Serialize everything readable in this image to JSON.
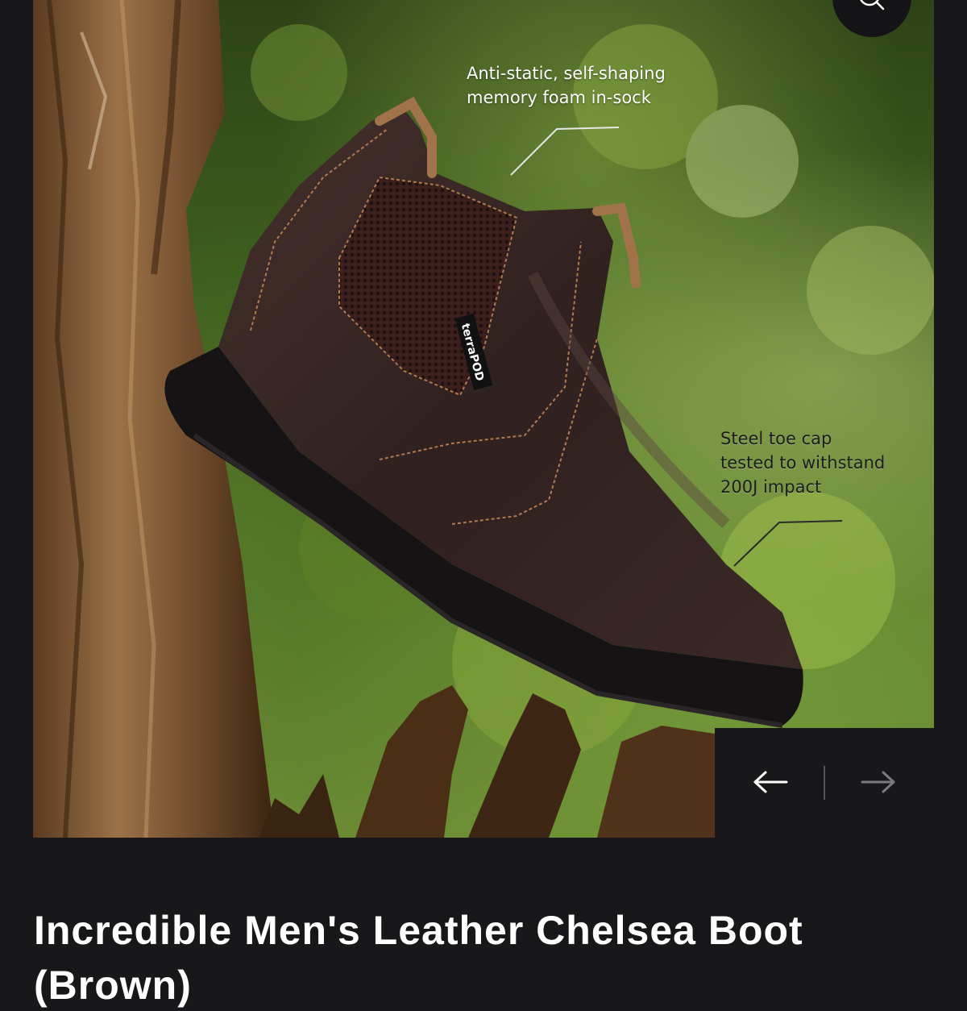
{
  "gallery": {
    "callouts": {
      "foam": "Anti-static, self-shaping\nmemory foam in-sock",
      "toe_cap": "Steel toe cap\ntested to withstand\n200J impact"
    },
    "boot_brand_tag": "terraPOD",
    "zoom_icon": "search-icon",
    "prev_icon": "arrow-left-icon",
    "next_icon": "arrow-right-icon"
  },
  "product": {
    "title": "Incredible Men's Leather Chelsea Boot (Brown)"
  },
  "colors": {
    "background": "#18181b",
    "boot_leather": "#2f2120",
    "text": "#ffffff"
  }
}
